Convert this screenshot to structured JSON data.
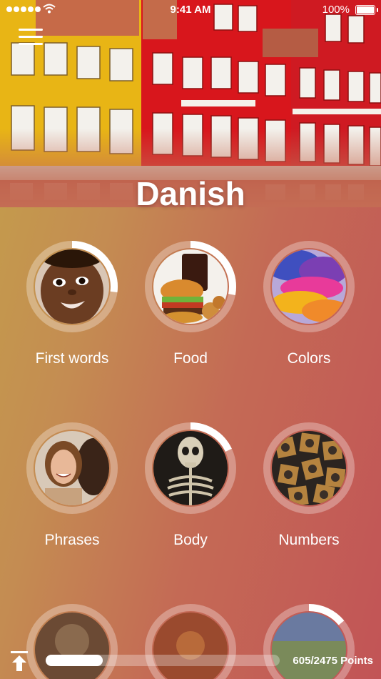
{
  "status": {
    "time": "9:41 AM",
    "battery": "100%"
  },
  "title": "Danish",
  "topics": [
    {
      "label": "First words",
      "progress": 0.27,
      "image": "child-face"
    },
    {
      "label": "Food",
      "progress": 0.28,
      "image": "burger-and-soda"
    },
    {
      "label": "Colors",
      "progress": 0,
      "image": "color-powder"
    },
    {
      "label": "Phrases",
      "progress": 0,
      "image": "couple-talking"
    },
    {
      "label": "Body",
      "progress": 0.18,
      "image": "skeleton"
    },
    {
      "label": "Numbers",
      "progress": 0,
      "image": "metal-type"
    },
    {
      "label": "",
      "progress": 0,
      "image": "partial-topic"
    },
    {
      "label": "",
      "progress": 0,
      "image": "partial-topic"
    },
    {
      "label": "",
      "progress": 0.14,
      "image": "partial-topic"
    }
  ],
  "points": {
    "text": "605/2475 Points",
    "value": 605,
    "total": 2475
  },
  "colors": {
    "accent": "#ffffff",
    "ring_track": "rgba(255,255,255,0.3)"
  }
}
